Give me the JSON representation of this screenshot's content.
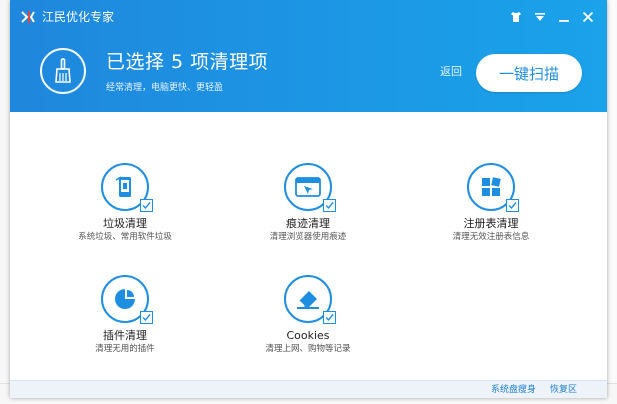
{
  "app": {
    "title": "江民优化专家"
  },
  "header": {
    "title": "已选择 5 项清理项",
    "subtitle": "经常清理，电脑更快、更轻盈",
    "back_label": "返回",
    "scan_label": "一键扫描"
  },
  "items": [
    {
      "label": "垃圾清理",
      "desc": "系统垃圾、常用软件垃圾",
      "icon": "trash-phone-icon",
      "checked": true
    },
    {
      "label": "痕迹清理",
      "desc": "清理浏览器使用痕迹",
      "icon": "browser-trace-icon",
      "checked": true
    },
    {
      "label": "注册表清理",
      "desc": "清理无效注册表信息",
      "icon": "registry-icon",
      "checked": true
    },
    {
      "label": "插件清理",
      "desc": "清理无用的插件",
      "icon": "plugin-icon",
      "checked": true
    },
    {
      "label": "Cookies",
      "desc": "清理上网、购物等记录",
      "icon": "eraser-icon",
      "checked": true
    }
  ],
  "footer": {
    "link1": "系统盘瘦身",
    "link2": "恢复区"
  },
  "colors": {
    "header_start": "#1f87dd",
    "header_end": "#1aa2ea",
    "accent": "#1e8fe0",
    "footer_link": "#1f7fd0"
  }
}
